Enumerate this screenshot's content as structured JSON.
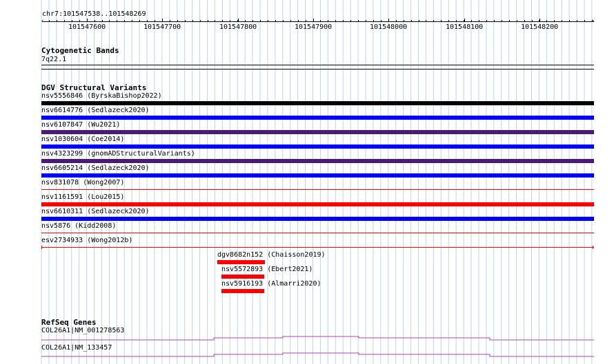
{
  "ruler": {
    "region": "chr7:101547538..101548269",
    "ticks": [
      "101547600",
      "101547700",
      "101547800",
      "101547900",
      "101548000",
      "101548100",
      "101548200"
    ]
  },
  "tracks": {
    "cytoband": {
      "title": "Cytogenetic Bands",
      "band": "7q22.1"
    },
    "dgv": {
      "title": "DGV Structural Variants",
      "variants": [
        {
          "label": "nsv5556846 (ByrskaBishop2022)",
          "color": "#000000",
          "style": "thick"
        },
        {
          "label": "nsv6614776 (Sedlazeck2020)",
          "color": "#0000ff",
          "style": "thick"
        },
        {
          "label": "nsv6107847 (Wu2021)",
          "color": "#4b1a78",
          "style": "thick"
        },
        {
          "label": "nsv1030604 (Coe2014)",
          "color": "#0000ff",
          "style": "thick"
        },
        {
          "label": "nsv4323299 (gnomADStructuralVariants)",
          "color": "#4b1a78",
          "style": "thick"
        },
        {
          "label": "nsv6605214 (Sedlazeck2020)",
          "color": "#0000ff",
          "style": "thick"
        },
        {
          "label": "nsv831078 (Wong2007)",
          "color": "#ff0000",
          "style": "thin"
        },
        {
          "label": "nsv1161591 (Lou2015)",
          "color": "#ff0000",
          "style": "thick"
        },
        {
          "label": "nsv6610311 (Sedlazeck2020)",
          "color": "#0000ff",
          "style": "thick"
        },
        {
          "label": "nsv5876 (Kidd2008)",
          "color": "#ff0000",
          "style": "thin"
        },
        {
          "label": "esv2734933 (Wong2012b)",
          "color": "#ff0000",
          "style": "thin"
        }
      ],
      "partial": [
        {
          "label": "dgv8682n152 (Chaisson2019)",
          "color": "#ff0000"
        },
        {
          "label": "nsv5572893 (Ebert2021)",
          "color": "#ff0000"
        },
        {
          "label": "nsv5916193 (Almarri2020)",
          "color": "#ff0000"
        }
      ]
    },
    "refseq": {
      "title": "RefSeq Genes",
      "genes": [
        {
          "label": "COL26A1|NM_001278563",
          "color": "#b040b0"
        },
        {
          "label": "COL26A1|NM_133457",
          "color": "#b040b0"
        }
      ]
    }
  }
}
